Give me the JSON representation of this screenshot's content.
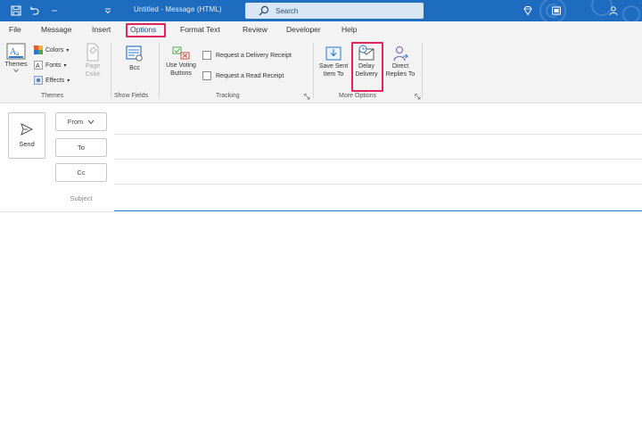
{
  "titlebar": {
    "title": "Untitled  -  Message (HTML)",
    "search_placeholder": "Search",
    "icons": [
      "save-icon",
      "undo-icon",
      "customize-quick-access-icon",
      "diamond-icon",
      "window-icon",
      "user-icon"
    ]
  },
  "menu": {
    "tabs": [
      "File",
      "Message",
      "Insert",
      "Options",
      "Format Text",
      "Review",
      "Developer",
      "Help"
    ],
    "active_tab": "Options",
    "highlighted_tab": "Options"
  },
  "ribbon": {
    "themes": {
      "themes_label": "Themes",
      "colors_label": "Colors",
      "fonts_label": "Fonts",
      "effects_label": "Effects",
      "page_color_label": "Page Color",
      "group_label": "Themes"
    },
    "show_fields": {
      "bcc_label": "Bcc",
      "group_label": "Show Fields"
    },
    "tracking": {
      "voting_label": "Use Voting Buttons",
      "delivery_receipt_label": "Request a Delivery Receipt",
      "read_receipt_label": "Request a Read Receipt",
      "group_label": "Tracking"
    },
    "more_options": {
      "save_sent_label": "Save Sent Item To",
      "delay_delivery_label": "Delay Delivery",
      "direct_replies_label": "Direct Replies To",
      "group_label": "More Options",
      "highlighted_button": "Delay Delivery"
    }
  },
  "compose": {
    "send_label": "Send",
    "from_label": "From",
    "to_label": "To",
    "cc_label": "Cc",
    "subject_label": "Subject"
  },
  "colors": {
    "titlebar": "#1e6cc0",
    "highlight": "#e0245e",
    "accent": "#2a78c8"
  }
}
